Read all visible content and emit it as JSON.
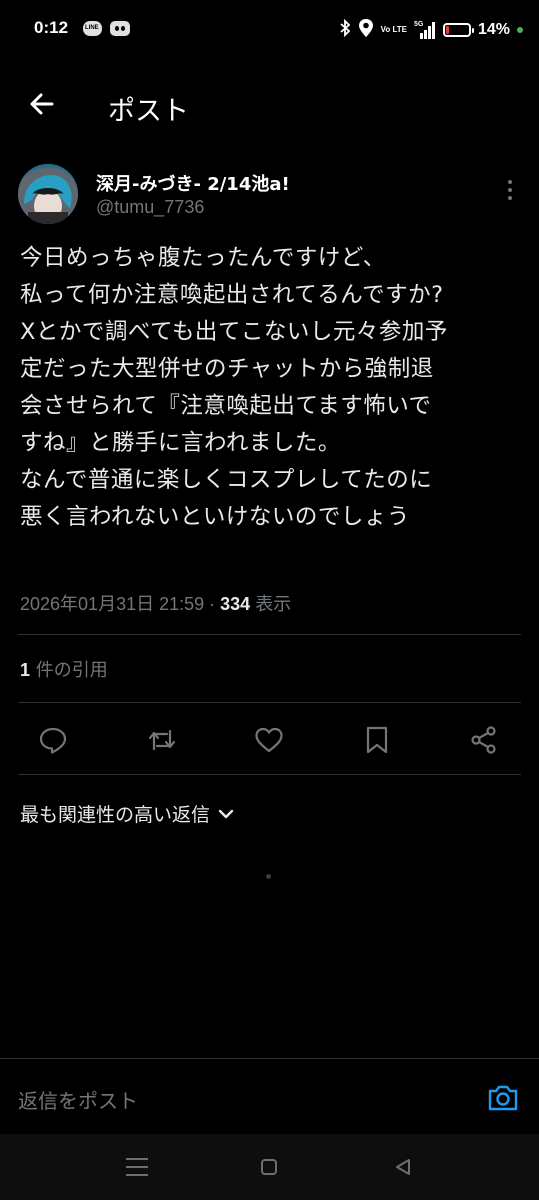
{
  "status_bar": {
    "time": "0:12",
    "line_icon_text": "LINE",
    "volte": "Vo LTE",
    "network": "5G",
    "battery_percent": "14%",
    "battery_level": 0.14,
    "battery_color": "#e53935",
    "indicator_color": "#4caf50"
  },
  "header": {
    "title": "ポスト"
  },
  "post": {
    "author_name": "深月-みづき- 2/14池a!",
    "author_handle": "@tumu_7736",
    "text_lines": [
      "今日めっちゃ腹たったんですけど、",
      "私って何か注意喚起出されてるんですか?",
      "Xとかで調べても出てこないし元々参加予",
      "定だった大型併せのチャットから強制退",
      "会させられて『注意喚起出てます怖いで",
      "すね』と勝手に言われました。",
      "なんで普通に楽しくコスプレしてたのに",
      "悪く言われないといけないのでしょう"
    ],
    "timestamp": "2026年01月31日 21:59",
    "separator": " · ",
    "views_count": "334",
    "views_label": " 表示",
    "quotes_count": "1",
    "quotes_label": " 件の引用"
  },
  "actions": [
    "reply-icon",
    "repost-icon",
    "like-icon",
    "bookmark-icon",
    "share-icon"
  ],
  "replies": {
    "sort_label": "最も関連性の高い返信"
  },
  "reply_bar": {
    "placeholder": "返信をポスト"
  },
  "colors": {
    "background": "#000000",
    "text_primary": "#e7e9ea",
    "text_secondary": "#71767b",
    "divider": "#2f3336",
    "accent": "#1d9bf0"
  }
}
